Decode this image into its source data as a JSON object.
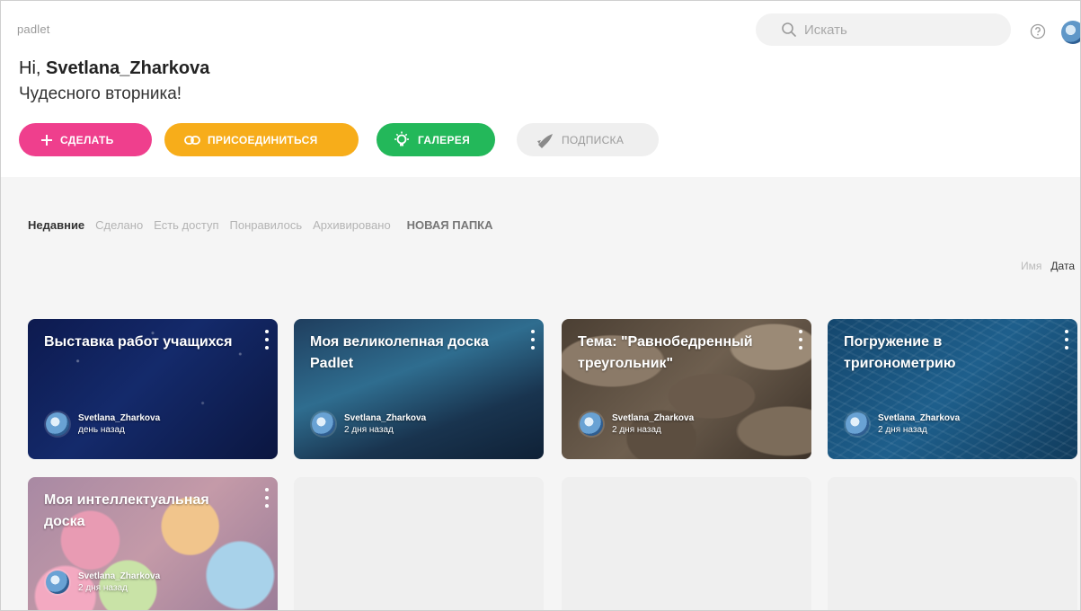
{
  "header": {
    "logo": "padlet",
    "search_placeholder": "Искать",
    "greeting_prefix": "Hi, ",
    "username": "Svetlana_Zharkova",
    "subtitle": "Чудесного вторника!"
  },
  "actions": {
    "make": "СДЕЛАТЬ",
    "join": "ПРИСОЕДИНИТЬСЯ",
    "gallery": "ГАЛЕРЕЯ",
    "subscription": "ПОДПИСКА"
  },
  "colors": {
    "make": "#ef3f8d",
    "join": "#f7ad1a",
    "gallery": "#23b85a",
    "subscription": "#efefef"
  },
  "tabs": [
    {
      "label": "Недавние",
      "active": true
    },
    {
      "label": "Сделано",
      "active": false
    },
    {
      "label": "Есть доступ",
      "active": false
    },
    {
      "label": "Понравилось",
      "active": false
    },
    {
      "label": "Архивировано",
      "active": false
    },
    {
      "label": "НОВАЯ ПАПКА",
      "active": false
    }
  ],
  "sort": {
    "name": "Имя",
    "date": "Дата"
  },
  "boards": [
    {
      "title": "Выставка работ учащихся",
      "author": "Svetlana_Zharkova",
      "time": "день назад"
    },
    {
      "title": "Моя великолепная доска Padlet",
      "author": "Svetlana_Zharkova",
      "time": "2 дня назад"
    },
    {
      "title": "Тема: \"Равнобедренный треугольник\"",
      "author": "Svetlana_Zharkova",
      "time": "2 дня назад"
    },
    {
      "title": "Погружение в тригонометрию",
      "author": "Svetlana_Zharkova",
      "time": "2 дня назад"
    },
    {
      "title": "Моя интеллектуальная доска",
      "author": "Svetlana_Zharkova",
      "time": "2 дня назад"
    }
  ],
  "icons": {
    "search": "search-icon",
    "help": "help-icon",
    "plus": "plus-icon",
    "link": "link-icon",
    "bulb": "lightbulb-icon",
    "rocket": "rocket-icon",
    "more": "more-vertical-icon"
  }
}
